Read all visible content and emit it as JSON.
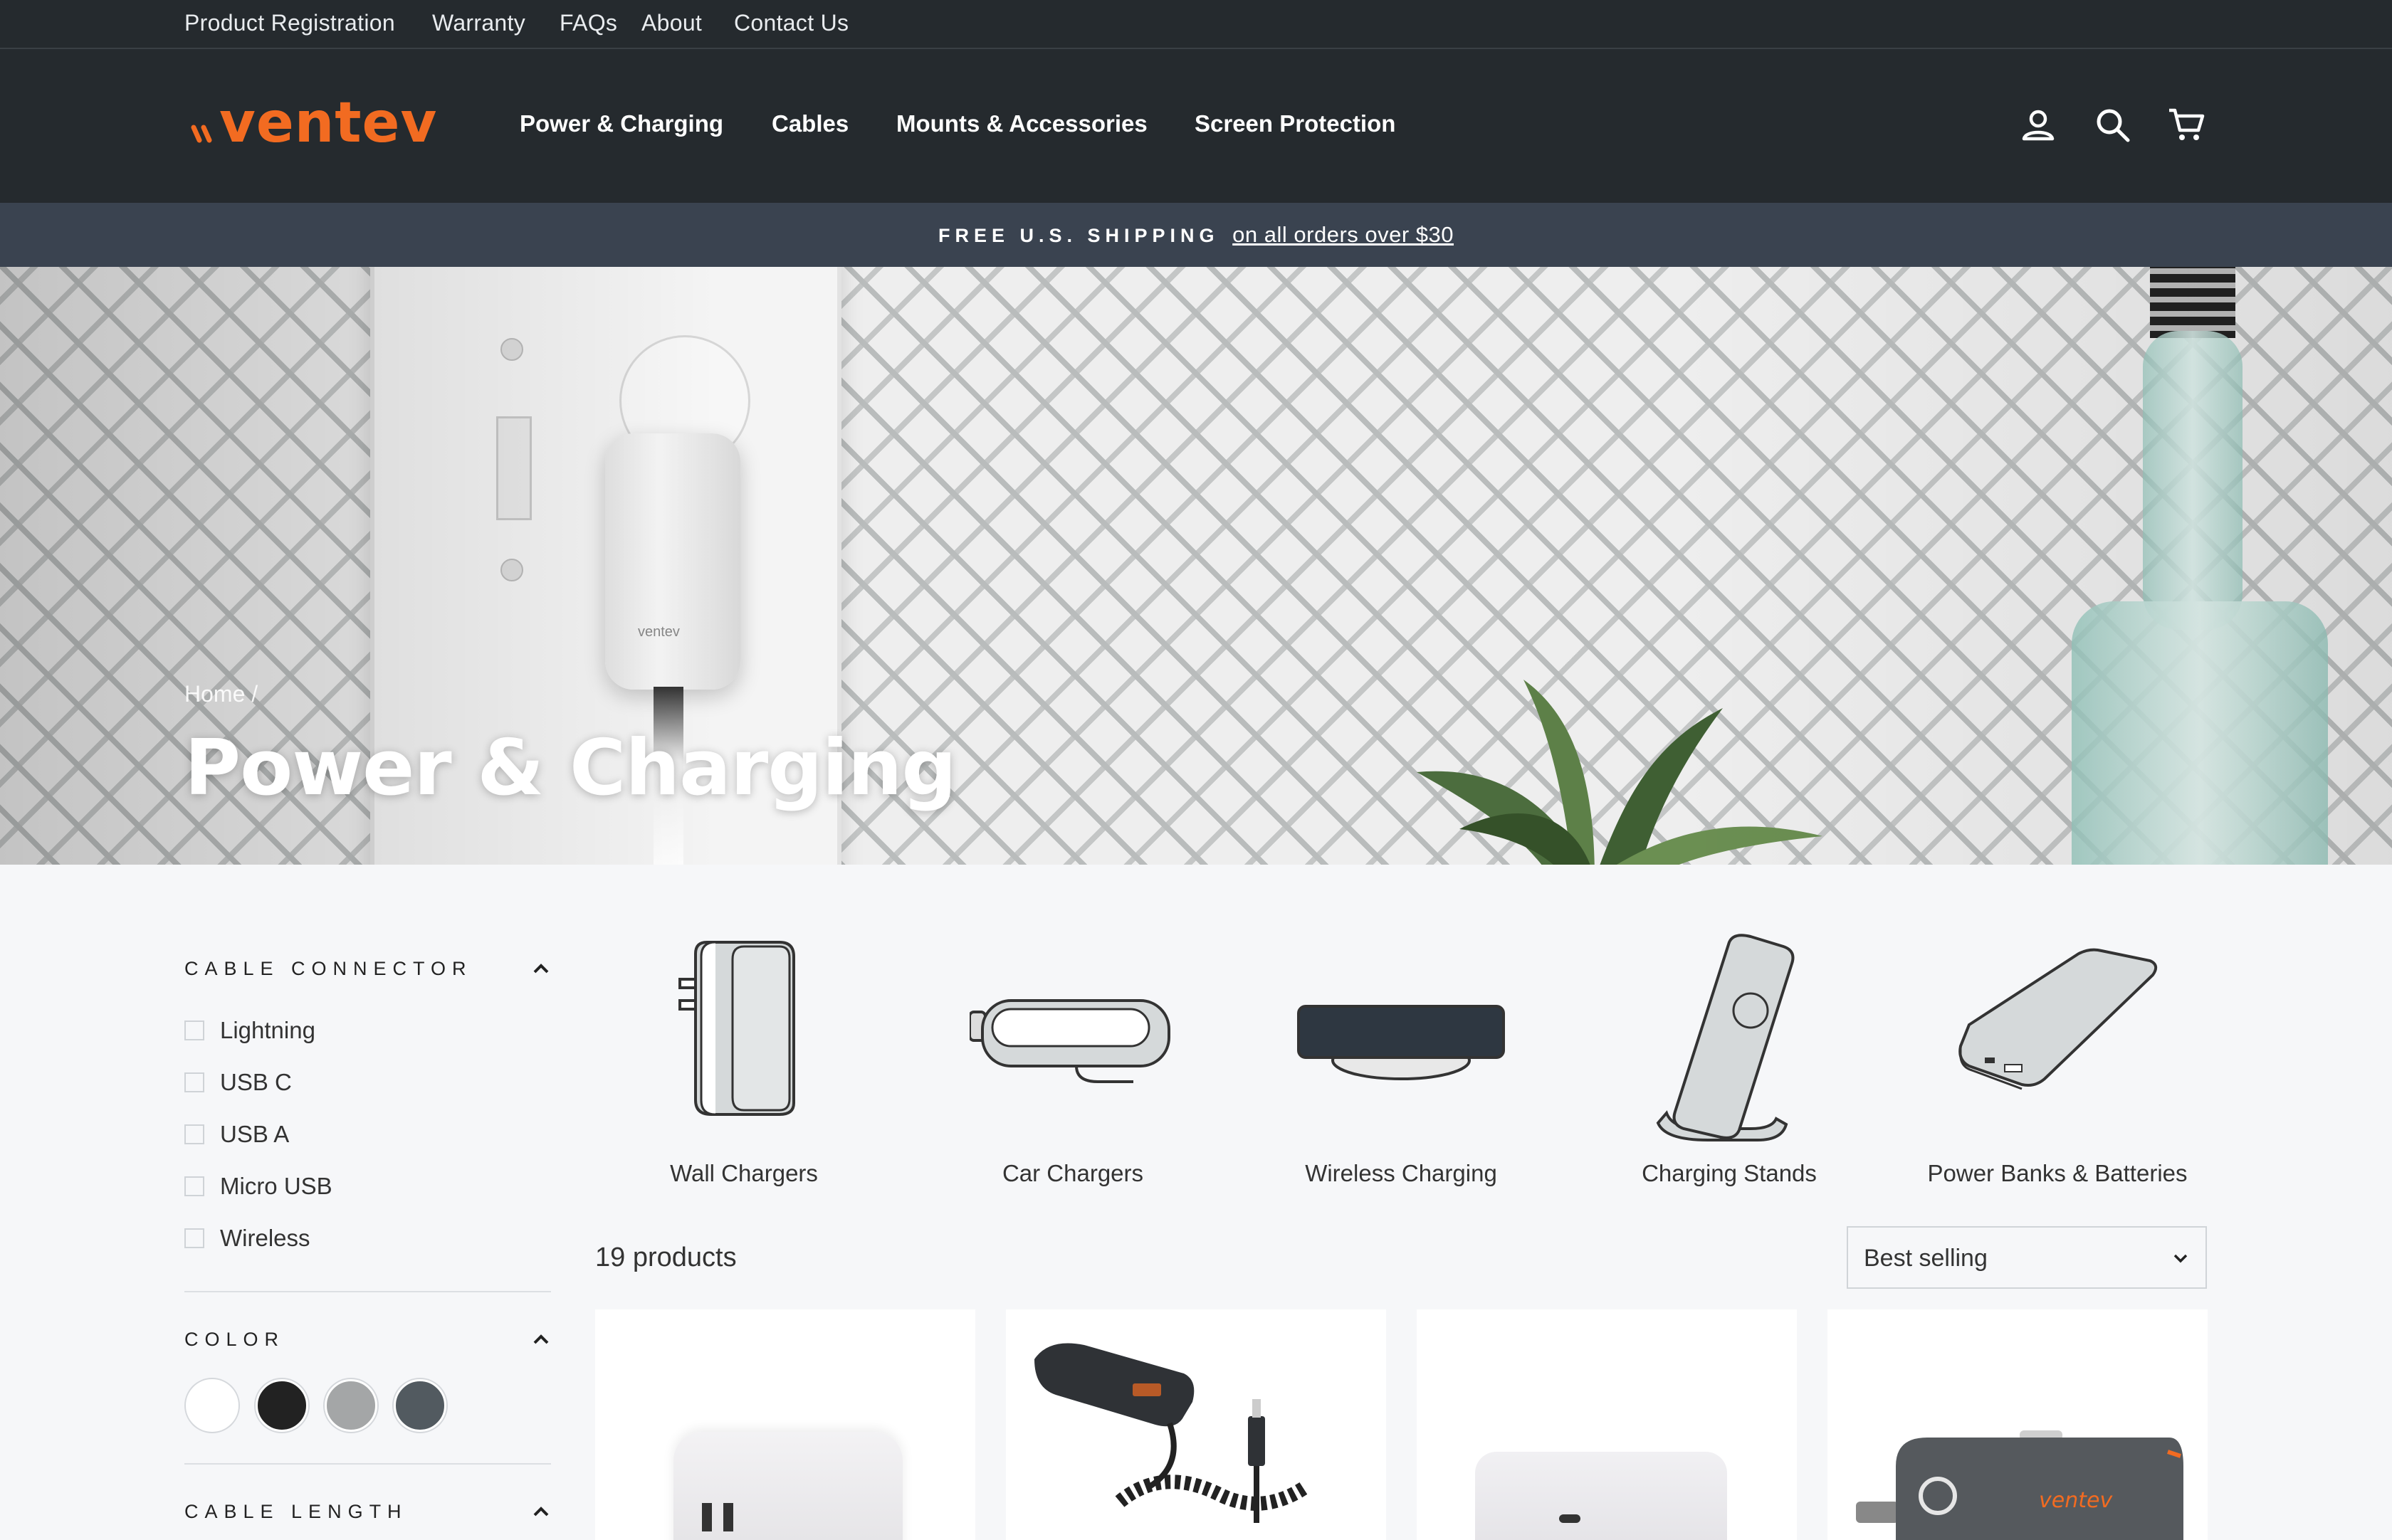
{
  "utility_nav": [
    "Product Registration",
    "Warranty",
    "FAQs",
    "About",
    "Contact Us"
  ],
  "brand": {
    "logo_text": "ventev",
    "accent": "#f26b21"
  },
  "main_nav": [
    "Power & Charging",
    "Cables",
    "Mounts & Accessories",
    "Screen Protection"
  ],
  "header_icons": [
    "account-icon",
    "search-icon",
    "cart-icon"
  ],
  "shipping": {
    "bold": "FREE U.S. SHIPPING",
    "link": "on all orders over $30"
  },
  "hero": {
    "breadcrumb": "Home /",
    "title": "Power & Charging",
    "plate_logo": "ventev"
  },
  "filters": {
    "cable_connector": {
      "title": "CABLE CONNECTOR",
      "options": [
        "Lightning",
        "USB C",
        "USB A",
        "Micro USB",
        "Wireless"
      ]
    },
    "color": {
      "title": "COLOR",
      "swatches": [
        "#ffffff",
        "#222222",
        "#a4a6a7",
        "#525a60"
      ]
    },
    "cable_length": {
      "title": "CABLE LENGTH"
    }
  },
  "categories": [
    "Wall Chargers",
    "Car Chargers",
    "Wireless Charging",
    "Charging Stands",
    "Power Banks & Batteries"
  ],
  "listing": {
    "count": "19 products",
    "sort": "Best selling"
  },
  "colors": {
    "topbar": "#252a2e",
    "shipbar": "#3a4350",
    "page_bg": "#f6f7f9"
  }
}
